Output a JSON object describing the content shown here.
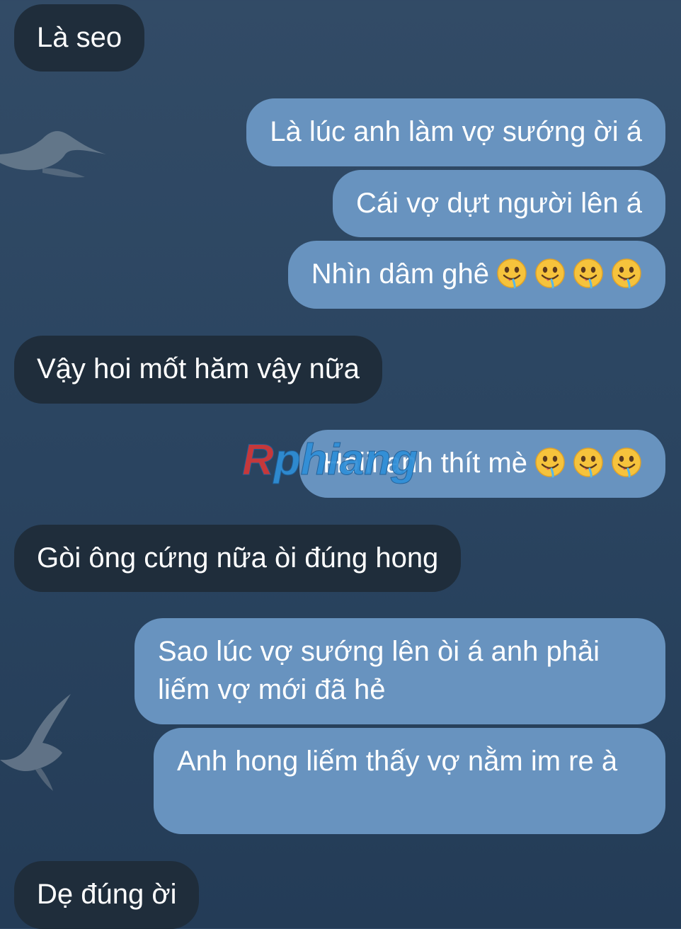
{
  "chat": {
    "messages": [
      {
        "side": "in",
        "text": "Là seo"
      },
      {
        "side": "out",
        "text": "Là lúc anh làm vợ sướng ời á"
      },
      {
        "side": "out",
        "text": "Cái vợ dựt người lên á"
      },
      {
        "side": "out",
        "text": "Nhìn dâm ghê",
        "emoji": "drooling-face",
        "emoji_count": 4
      },
      {
        "side": "in",
        "text": "Vậy hoi mốt hăm vậy nữa"
      },
      {
        "side": "out",
        "text": "Hoiii anh thít mè",
        "emoji": "drooling-face",
        "emoji_count": 3
      },
      {
        "side": "in",
        "text": "Gòi ông cứng nữa òi đúng hong"
      },
      {
        "side": "out",
        "text": "Sao lúc vợ sướng lên òi á anh phải liếm vợ mới đã hẻ"
      },
      {
        "side": "out",
        "text": "Anh hong liếm thấy vợ nằm im re à"
      },
      {
        "side": "in",
        "text": "Dẹ đúng ời"
      }
    ]
  },
  "watermark": {
    "text": "Rphiang"
  },
  "colors": {
    "background": "#2b4561",
    "incoming_bubble": "#1f2d3b",
    "outgoing_bubble": "#6893bf",
    "text": "#ffffff"
  },
  "icons": [
    "seagull-icon",
    "drooling-face-emoji"
  ]
}
